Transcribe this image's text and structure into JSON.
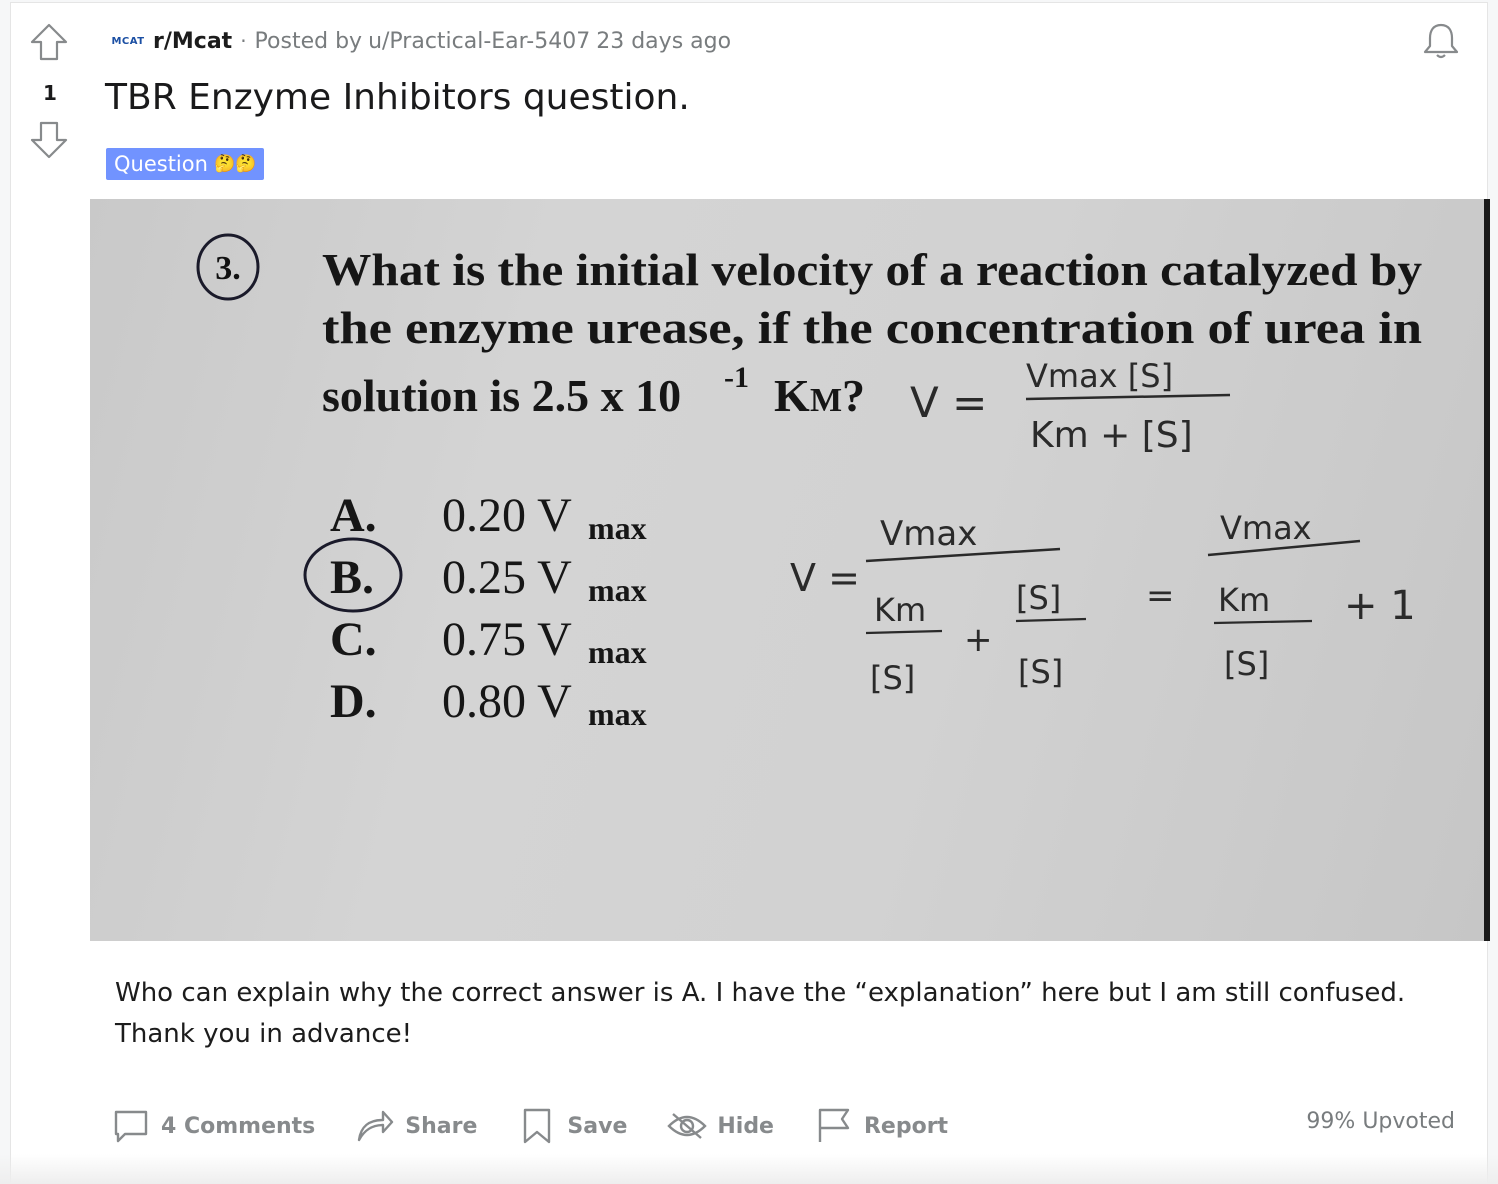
{
  "vote": {
    "count": "1"
  },
  "post": {
    "subreddit_icon_text": "MCAT",
    "subreddit": "r/Mcat",
    "separator": "·",
    "posted_by": "Posted by",
    "user": "u/Practical-Ear-5407",
    "time": "23 days ago",
    "title": "TBR Enzyme Inhibitors question.",
    "flair": "Question",
    "flair_emoji": "🤔🤔",
    "body": "Who can explain why the correct answer is A. I have the “explanation” here but I am still confused. Thank you in advance!"
  },
  "image": {
    "question_number": "3.",
    "question_lines": [
      "What is the initial velocity of a reaction catalyzed by",
      "the enzyme urease, if the concentration of urea in",
      "solution is 2.5 x 10"
    ],
    "exponent": "-1",
    "km": "K",
    "km_sub": "M",
    "question_end": "?",
    "choices": [
      {
        "letter": "A.",
        "value": "0.20 V",
        "sub": "max"
      },
      {
        "letter": "B.",
        "value": "0.25 V",
        "sub": "max"
      },
      {
        "letter": "C.",
        "value": "0.75 V",
        "sub": "max"
      },
      {
        "letter": "D.",
        "value": "0.80 V",
        "sub": "max"
      }
    ],
    "handwriting": {
      "v_eq": "V =",
      "vmax_s": "Vmax [S]",
      "km_plus_s": "Km + [S]",
      "v2": "V =",
      "vmax": "Vmax",
      "km": "Km",
      "s": "[S]",
      "plus": "+",
      "eq": "=",
      "vmax2": "Vmax",
      "kn": "Km",
      "plus1": "+ 1",
      "s2": "[S]"
    }
  },
  "actions": {
    "comments": "4 Comments",
    "share": "Share",
    "save": "Save",
    "hide": "Hide",
    "report": "Report"
  },
  "upvoted": "99% Upvoted",
  "colors": {
    "flair_bg": "#7193ff",
    "meta_gray": "#787c7e",
    "action_gray": "#878a8c"
  }
}
